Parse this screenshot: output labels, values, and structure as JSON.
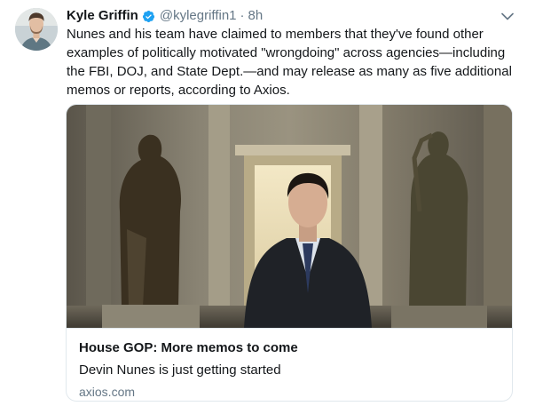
{
  "tweet": {
    "author_name": "Kyle Griffin",
    "handle": "@kylegriffin1",
    "separator": "·",
    "timestamp": "8h",
    "verified": true,
    "text": "Nunes and his team have claimed to members that they've found other examples of politically motivated \"wrongdoing\" across agencies—including the FBI, DOJ, and State Dept.—and may release as many as five additional memos or reports, according to Axios.",
    "menu_icon": "chevron-down-icon"
  },
  "card": {
    "title": "House GOP: More memos to come",
    "description": "Devin Nunes is just getting started",
    "domain": "axios.com"
  },
  "colors": {
    "text_primary": "#14171a",
    "text_secondary": "#657786",
    "verified_blue": "#1da1f2",
    "border": "#e1e8ed"
  }
}
